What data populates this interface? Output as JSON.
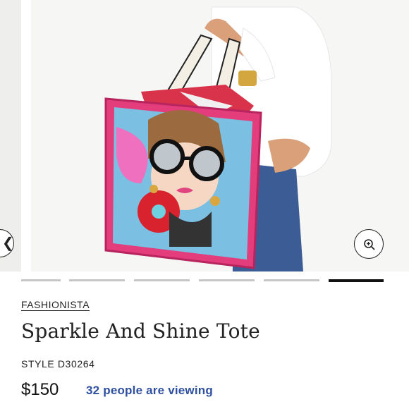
{
  "hero": {
    "image_alt": "Model holding a colorful illustrated tote bag",
    "prev_icon": "chevron-left-icon",
    "zoom_icon": "zoom-in-icon",
    "slide_count": 6,
    "active_slide": 6
  },
  "product": {
    "brand": "FASHIONISTA",
    "title": "Sparkle And Shine Tote",
    "style": "STYLE D30264",
    "price": "$150",
    "viewing": "32 people are viewing"
  },
  "colors": {
    "viewing_text": "#2f4fa0",
    "active_dot": "#111111",
    "inactive_dot": "#c6c6c6"
  }
}
